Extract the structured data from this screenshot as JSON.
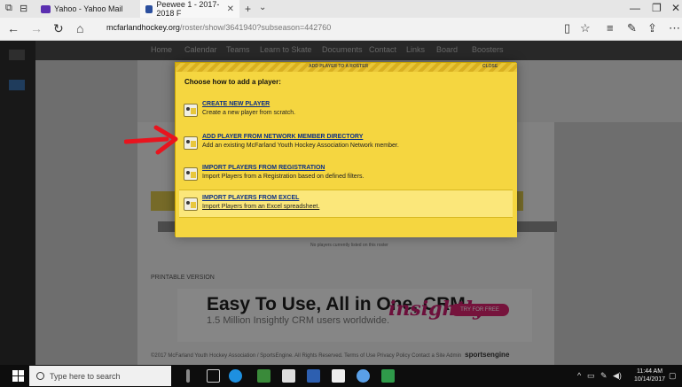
{
  "browser": {
    "tabs": [
      {
        "label": "Yahoo - Yahoo Mail",
        "active": false
      },
      {
        "label": "Peewee 1 - 2017-2018 F",
        "active": true
      }
    ],
    "url_host": "mcfarlandhockey.org",
    "url_rest": "/roster/show/3641940?subseason=442760"
  },
  "site_nav": [
    "Home",
    "Calendar",
    "Teams",
    "Learn to Skate",
    "Documents",
    "Contact",
    "Links",
    "Board",
    "Boosters"
  ],
  "modal": {
    "title": "ADD PLAYER TO A ROSTER",
    "close_label": "CLOSE",
    "prompt": "Choose how to add a player:",
    "options": [
      {
        "title": "CREATE NEW PLAYER",
        "desc": "Create a new player from scratch."
      },
      {
        "title": "ADD PLAYER FROM NETWORK MEMBER DIRECTORY",
        "desc": "Add an existing McFarland Youth Hockey Association Network member."
      },
      {
        "title": "IMPORT PLAYERS FROM REGISTRATION",
        "desc": "Import Players from a Registration based on defined filters."
      },
      {
        "title": "IMPORT PLAYERS FROM EXCEL",
        "desc": "Import Players from an Excel spreadsheet."
      }
    ]
  },
  "page_bg": {
    "printable": "PRINTABLE VERSION",
    "empty_msg": "No players currently listed on this roster",
    "ad_headline": "Easy To Use, All in One, CRM.",
    "ad_sub": "1.5 Million Insightly CRM users worldwide.",
    "ad_brand": "insightly",
    "ad_button": "TRY FOR FREE",
    "footer": "©2017 McFarland Youth Hockey Association / SportsEngine. All Rights Reserved. Terms of Use  Privacy Policy  Contact a Site Admin",
    "footer_brand": "sportsengine"
  },
  "taskbar": {
    "search_placeholder": "Type here to search",
    "time": "11:44 AM",
    "date": "10/14/2017"
  },
  "colors": {
    "modal_bg": "#f5d640",
    "link": "#0b2f86",
    "arrow": "#e8141e",
    "ad_brand": "#c51d6c"
  }
}
